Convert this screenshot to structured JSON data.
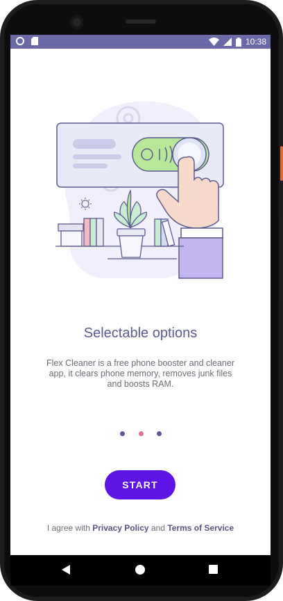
{
  "status_bar": {
    "time": "10:38",
    "icons": [
      "circle-notification-icon",
      "sd-card-icon",
      "wifi-icon",
      "signal-icon",
      "battery-icon"
    ]
  },
  "onboarding": {
    "title": "Selectable options",
    "description": "Flex Cleaner is a free phone booster and cleaner app, it clears phone memory, removes junk files and boosts RAM.",
    "page_indicator": {
      "count": 3,
      "active_index": 1
    },
    "start_button": "START",
    "agreement": {
      "prefix": "I agree with",
      "privacy_link": "Privacy Policy",
      "joiner": "and",
      "terms_link": "Terms of Service"
    }
  },
  "colors": {
    "status_bar": "#6c6aa6",
    "primary_button": "#5f14e6",
    "title_text": "#5a5b8f",
    "active_dot": "#d97393",
    "inactive_dot": "#5b5b9a",
    "toggle_green": "#b7e89a"
  },
  "navigation_bar": {
    "icons": [
      "back-icon",
      "home-icon",
      "recent-apps-icon"
    ]
  }
}
